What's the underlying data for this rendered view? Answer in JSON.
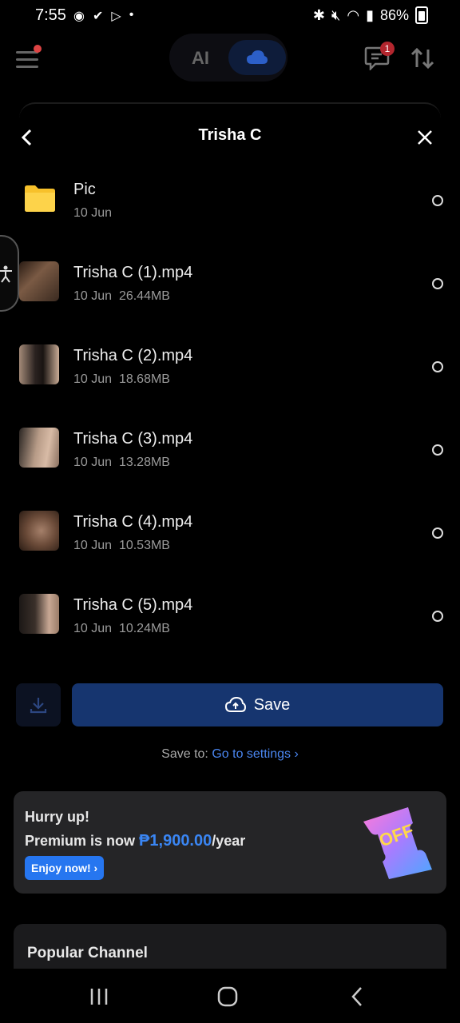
{
  "status_bar": {
    "time": "7:55",
    "battery": "86%"
  },
  "header": {
    "mode_ai": "AI",
    "notification_count": "1"
  },
  "sheet": {
    "title": "Trisha C"
  },
  "files": [
    {
      "name": "Pic",
      "date": "10 Jun",
      "size": "",
      "type": "folder"
    },
    {
      "name": "Trisha C (1).mp4",
      "date": "10 Jun",
      "size": "26.44MB",
      "type": "video"
    },
    {
      "name": "Trisha C (2).mp4",
      "date": "10 Jun",
      "size": "18.68MB",
      "type": "video"
    },
    {
      "name": "Trisha C (3).mp4",
      "date": "10 Jun",
      "size": "13.28MB",
      "type": "video"
    },
    {
      "name": "Trisha C (4).mp4",
      "date": "10 Jun",
      "size": "10.53MB",
      "type": "video"
    },
    {
      "name": "Trisha C (5).mp4",
      "date": "10 Jun",
      "size": "10.24MB",
      "type": "video"
    }
  ],
  "actions": {
    "save_label": "Save",
    "save_to_label": "Save to:",
    "settings_link": "Go to settings"
  },
  "promo": {
    "headline": "Hurry up!",
    "text_before": "Premium is now ",
    "price": "₱1,900.00",
    "text_after": "/year",
    "button": "Enjoy now!",
    "ticket_text": "OFF"
  },
  "popular": {
    "title": "Popular Channel"
  },
  "colors": {
    "accent": "#2676f0",
    "save_button": "#16356f",
    "background": "#000000"
  }
}
